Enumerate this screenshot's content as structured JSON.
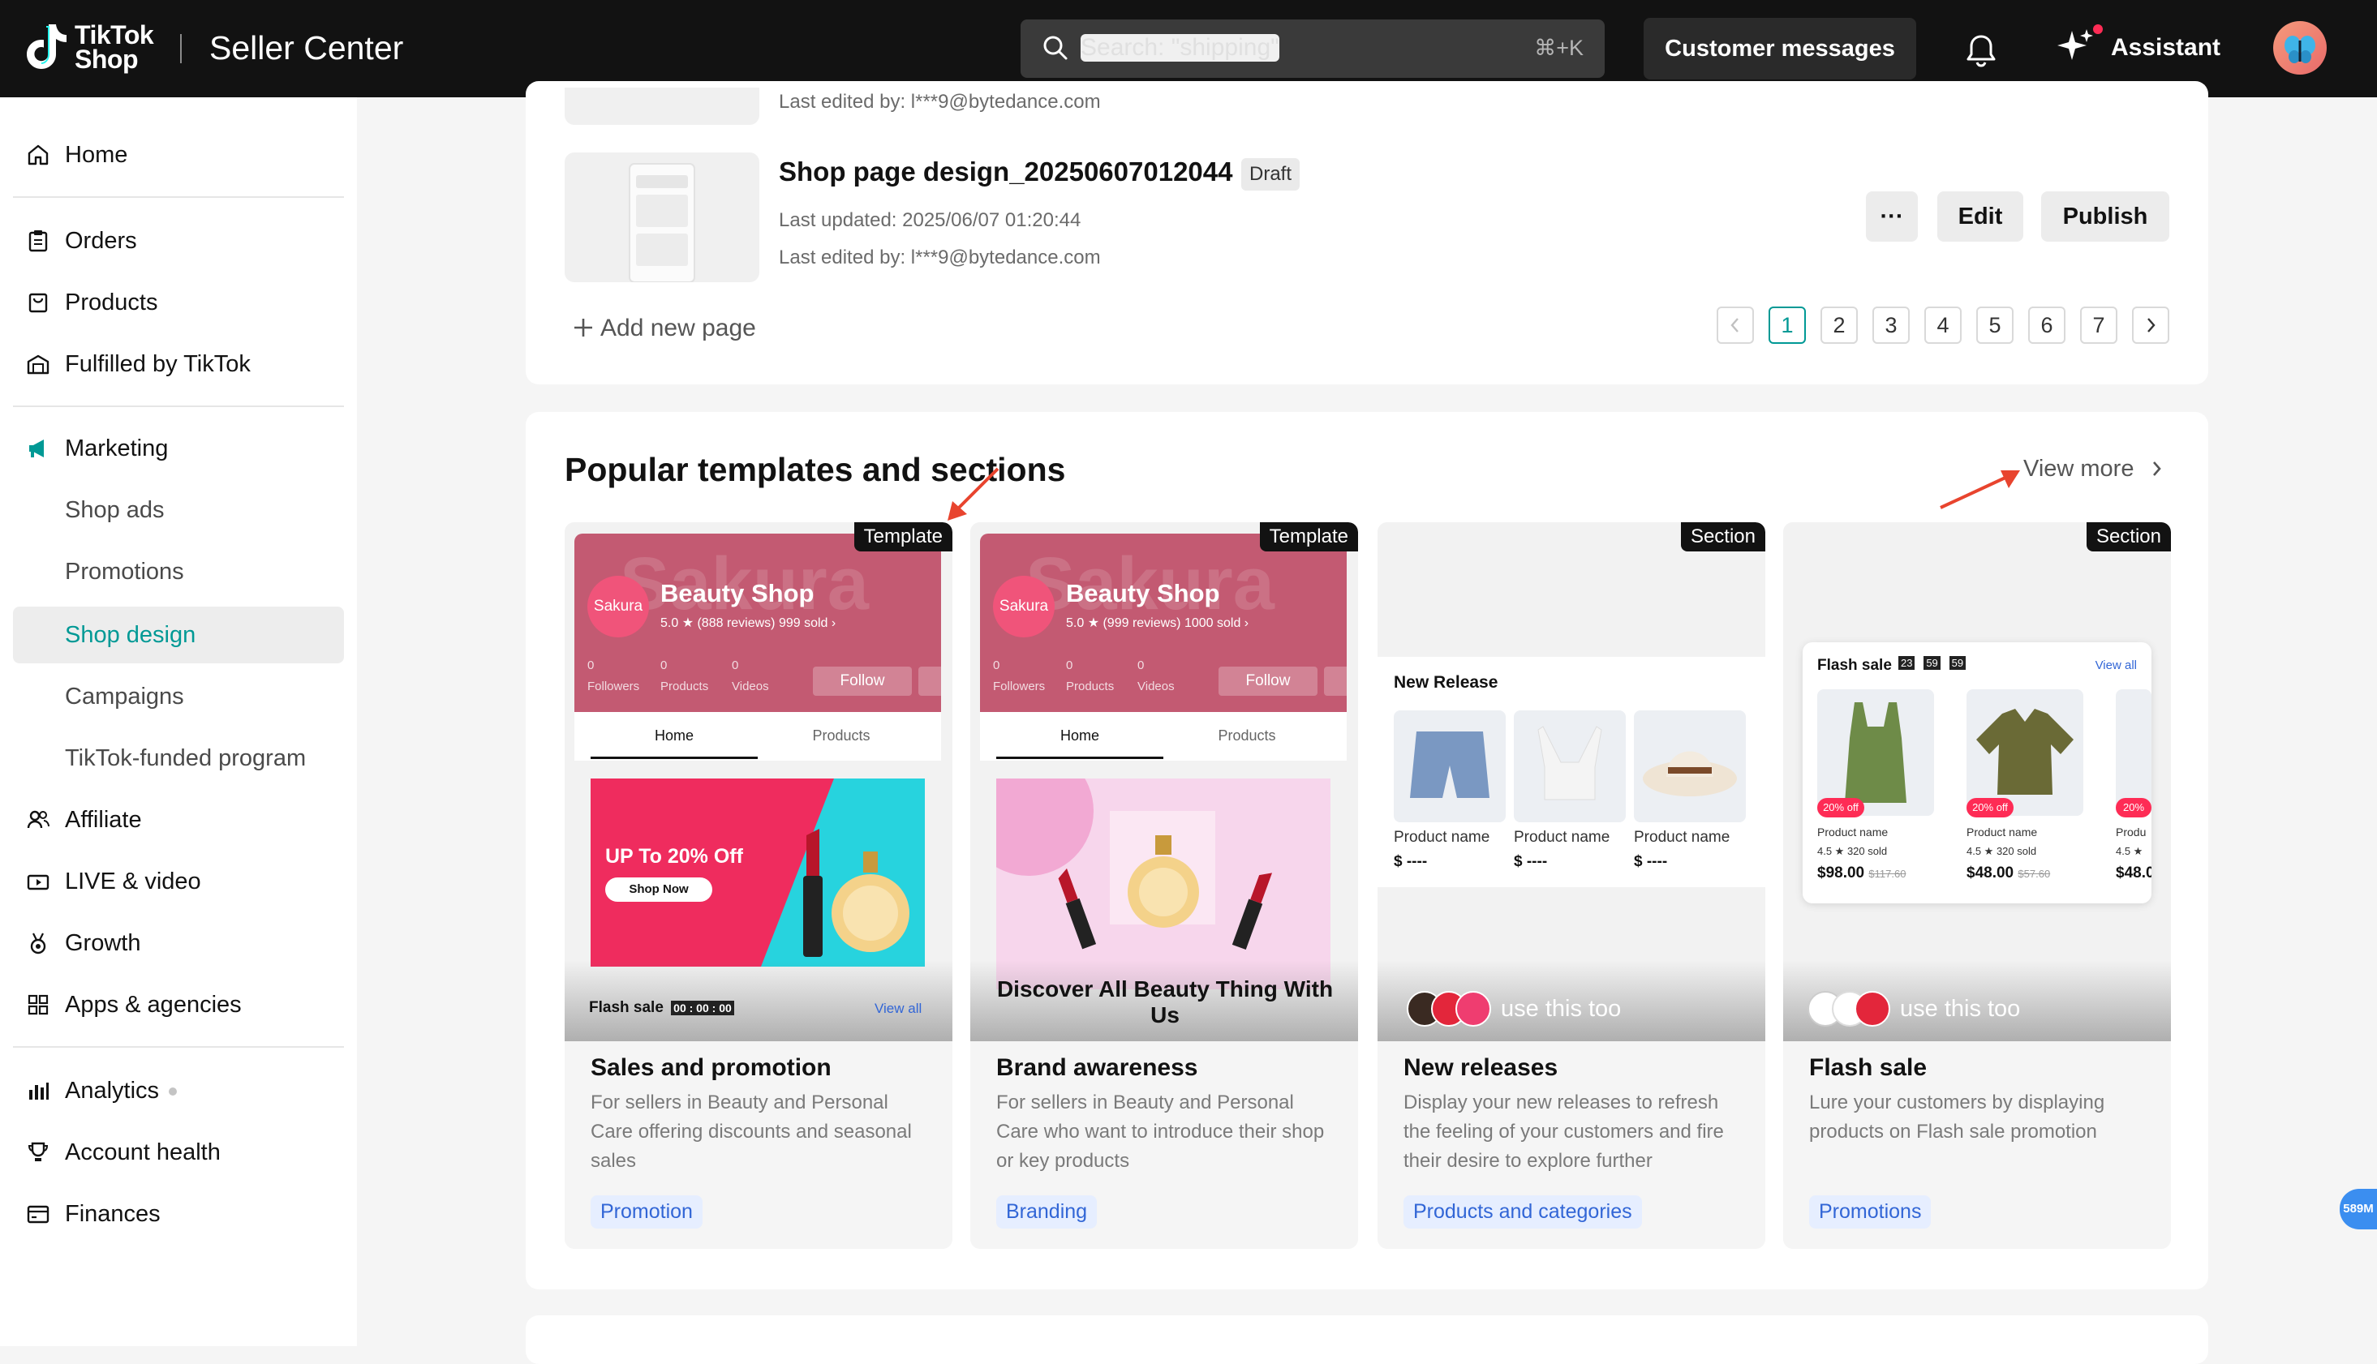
{
  "header": {
    "logo_text": "TikTok Shop",
    "logo_line1": "TikTok",
    "logo_line2": "Shop",
    "title": "Seller Center",
    "search_placeholder": "Search: \"shipping\"",
    "search_shortcut": "⌘+K",
    "customer_messages": "Customer messages",
    "assistant": "Assistant"
  },
  "sidebar": {
    "home": "Home",
    "orders": "Orders",
    "products": "Products",
    "fulfilled": "Fulfilled by TikTok",
    "marketing": "Marketing",
    "shop_ads": "Shop ads",
    "promotions": "Promotions",
    "shop_design": "Shop design",
    "campaigns": "Campaigns",
    "tiktok_funded": "TikTok-funded program",
    "affiliate": "Affiliate",
    "live_video": "LIVE & video",
    "growth": "Growth",
    "apps": "Apps & agencies",
    "analytics": "Analytics",
    "account_health": "Account health",
    "finances": "Finances"
  },
  "pages": {
    "prev_edited": "Last edited by: l***9@bytedance.com",
    "item_title": "Shop page design_20250607012044",
    "item_badge": "Draft",
    "item_updated": "Last updated: 2025/06/07 01:20:44",
    "item_edited": "Last edited by: l***9@bytedance.com",
    "more": "···",
    "edit": "Edit",
    "publish": "Publish",
    "add_new_page": "Add new page",
    "pagination": [
      "1",
      "2",
      "3",
      "4",
      "5",
      "6",
      "7"
    ]
  },
  "templates": {
    "title": "Popular templates and sections",
    "view_more": "View more",
    "cards": [
      {
        "tag": "Template",
        "name": "Sales and promotion",
        "desc": "For sellers in Beauty and Personal Care offering discounts and seasonal sales",
        "chip": "Promotion",
        "shop_name": "Beauty Shop",
        "shop_logo": "Sakura",
        "shop_watermark": "Sakura",
        "rating": "5.0 ★ (888 reviews)  999 sold ›",
        "stats": [
          {
            "n": "0",
            "l": "Followers"
          },
          {
            "n": "0",
            "l": "Products"
          },
          {
            "n": "0",
            "l": "Videos"
          }
        ],
        "follow": "Follow",
        "tab_home": "Home",
        "tab_products": "Products",
        "banner_text": "UP To 20% Off",
        "banner_btn": "Shop Now",
        "strip": "Flash sale",
        "strip_timer": "00 : 00 : 00",
        "strip_link": "View all"
      },
      {
        "tag": "Template",
        "name": "Brand awareness",
        "desc": "For sellers in Beauty and Personal Care who want to introduce their shop or key products",
        "chip": "Branding",
        "shop_name": "Beauty Shop",
        "shop_logo": "Sakura",
        "shop_watermark": "Sakura",
        "rating": "5.0 ★ (999 reviews)  1000 sold ›",
        "stats": [
          {
            "n": "0",
            "l": "Followers"
          },
          {
            "n": "0",
            "l": "Products"
          },
          {
            "n": "0",
            "l": "Videos"
          }
        ],
        "follow": "Follow",
        "tab_home": "Home",
        "tab_products": "Products",
        "banner_text": "Discover All Beauty Thing With Us"
      },
      {
        "tag": "Section",
        "name": "New releases",
        "desc": "Display your new releases to refresh the feeling of your customers and fire their desire to explore further",
        "chip": "Products and categories",
        "section_title": "New Release",
        "products": [
          {
            "n": "Product name",
            "p": "$ ----"
          },
          {
            "n": "Product name",
            "p": "$ ----"
          },
          {
            "n": "Product name",
            "p": "$ ----"
          }
        ],
        "use": "use this too"
      },
      {
        "tag": "Section",
        "name": "Flash sale",
        "desc": "Lure your customers by displaying products on Flash sale promotion",
        "chip": "Promotions",
        "fs_title": "Flash sale",
        "fs_timer": [
          "23",
          "59",
          "59"
        ],
        "fs_view": "View all",
        "products": [
          {
            "badge": "20% off",
            "n": "Product name",
            "r": "4.5 ★   320 sold",
            "p": "$98.00",
            "o": "$117.60"
          },
          {
            "badge": "20% off",
            "n": "Product name",
            "r": "4.5 ★   320 sold",
            "p": "$48.00",
            "o": "$57.60"
          },
          {
            "badge": "20%",
            "n": "Produ",
            "r": "4.5 ★",
            "p": "$48.0",
            "o": ""
          }
        ],
        "use": "use this too"
      }
    ]
  },
  "fab": "589M",
  "colors": {
    "accent": "#009995",
    "topbar": "#121212",
    "chip_bg": "#e6eeff",
    "chip_fg": "#3266d6",
    "annotation": "#e8442e"
  }
}
